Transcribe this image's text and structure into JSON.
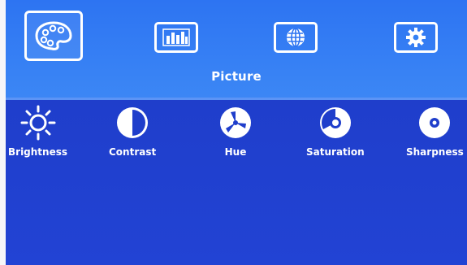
{
  "menu": {
    "title": "Picture",
    "tabs": [
      {
        "icon": "palette-icon",
        "active": true
      },
      {
        "icon": "display-bars-icon",
        "active": false
      },
      {
        "icon": "globe-icon",
        "active": false
      },
      {
        "icon": "gear-icon",
        "active": false
      }
    ]
  },
  "items": [
    {
      "label": "Brightness",
      "icon": "sun-icon"
    },
    {
      "label": "Contrast",
      "icon": "half-circle-icon"
    },
    {
      "label": "Hue",
      "icon": "hue-wheel-icon"
    },
    {
      "label": "Saturation",
      "icon": "saturation-icon"
    },
    {
      "label": "Sharpness",
      "icon": "sharpness-icon"
    }
  ],
  "colors": {
    "header": "#3481f4",
    "body": "#1f3fd0",
    "text": "#ffffff"
  }
}
